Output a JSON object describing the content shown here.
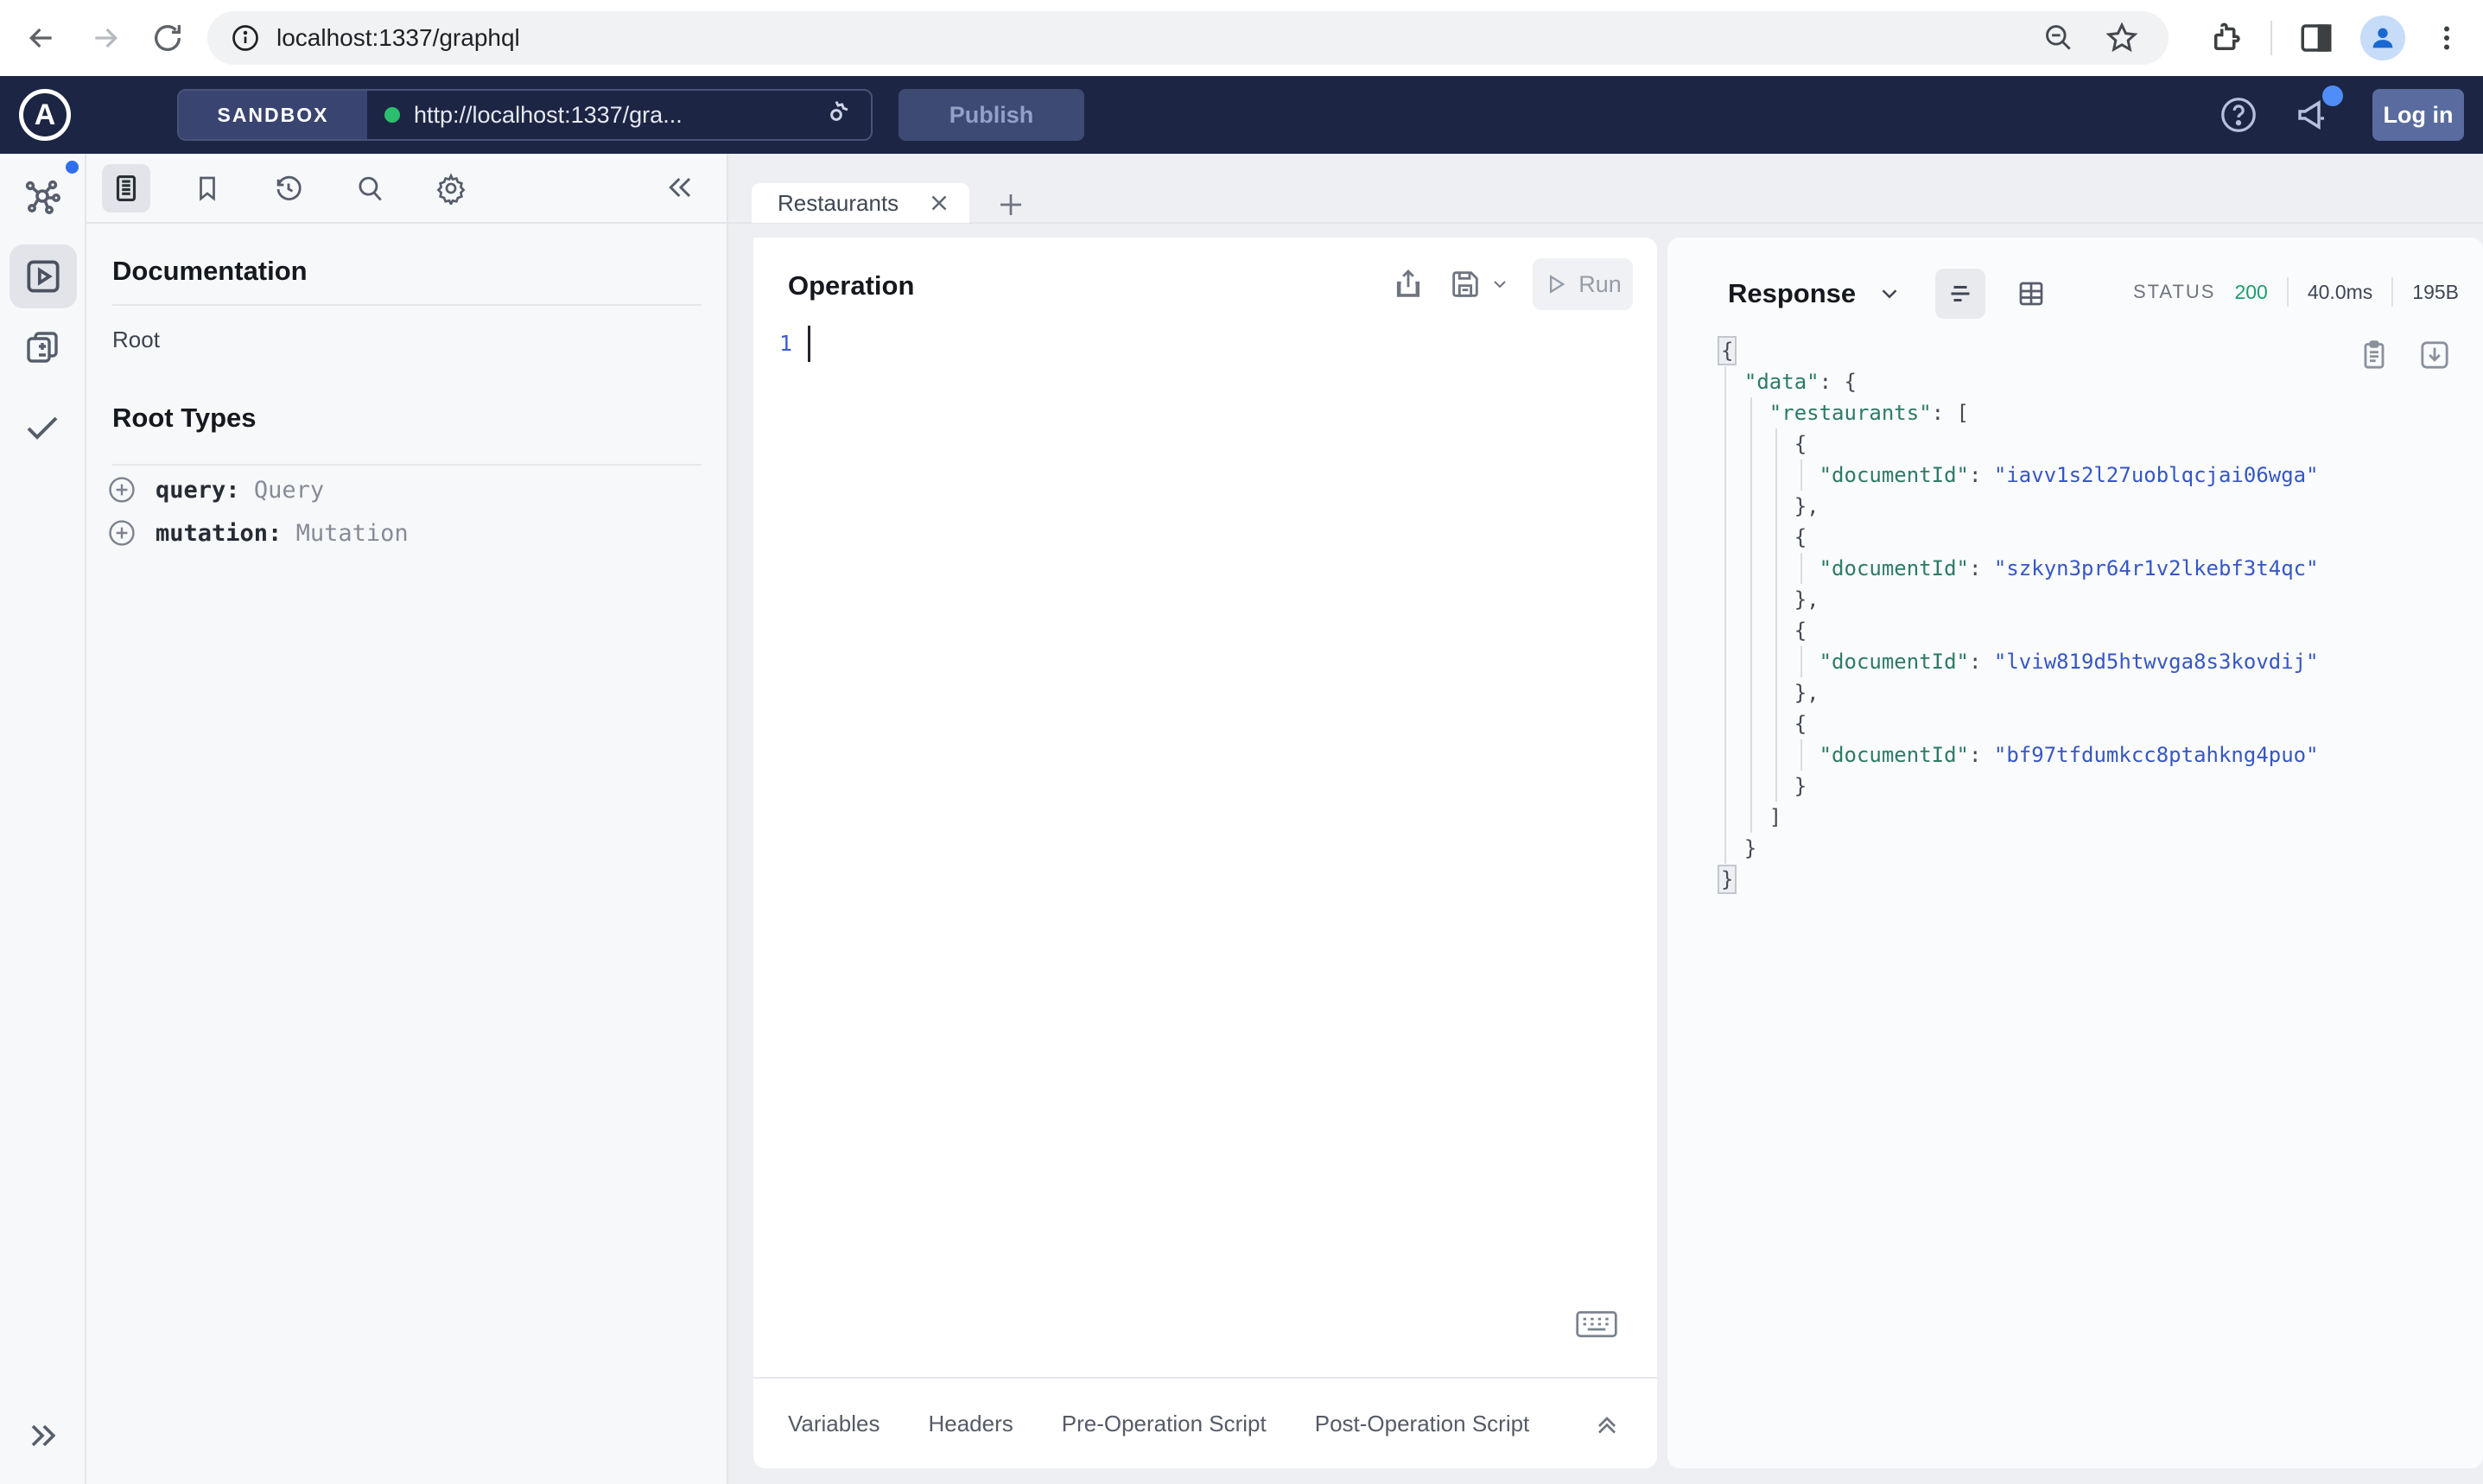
{
  "browser": {
    "url": "localhost:1337/graphql"
  },
  "header": {
    "logo_letter": "A",
    "sandbox_label": "SANDBOX",
    "endpoint_url": "http://localhost:1337/gra...",
    "publish_label": "Publish",
    "login_label": "Log in"
  },
  "docs": {
    "title": "Documentation",
    "root_label": "Root",
    "root_types_title": "Root Types",
    "entries": [
      {
        "name": "query:",
        "type": "Query"
      },
      {
        "name": "mutation:",
        "type": "Mutation"
      }
    ]
  },
  "editor": {
    "tab_label": "Restaurants",
    "panel_title": "Operation",
    "run_label": "Run",
    "line_number": "1"
  },
  "response": {
    "panel_title": "Response",
    "status_label": "STATUS",
    "status_code": "200",
    "time": "40.0ms",
    "size": "195B",
    "json_lines": [
      [
        [
          "f",
          "{"
        ]
      ],
      [
        [
          "p",
          "  "
        ],
        [
          "k",
          "\"data\""
        ],
        [
          "p",
          ": {"
        ]
      ],
      [
        [
          "p",
          "    "
        ],
        [
          "k",
          "\"restaurants\""
        ],
        [
          "p",
          ": ["
        ]
      ],
      [
        [
          "p",
          "      {"
        ]
      ],
      [
        [
          "p",
          "        "
        ],
        [
          "k",
          "\"documentId\""
        ],
        [
          "p",
          ": "
        ],
        [
          "v",
          "\"iavv1s2l27uoblqcjai06wga\""
        ]
      ],
      [
        [
          "p",
          "      },"
        ]
      ],
      [
        [
          "p",
          "      {"
        ]
      ],
      [
        [
          "p",
          "        "
        ],
        [
          "k",
          "\"documentId\""
        ],
        [
          "p",
          ": "
        ],
        [
          "v",
          "\"szkyn3pr64r1v2lkebf3t4qc\""
        ]
      ],
      [
        [
          "p",
          "      },"
        ]
      ],
      [
        [
          "p",
          "      {"
        ]
      ],
      [
        [
          "p",
          "        "
        ],
        [
          "k",
          "\"documentId\""
        ],
        [
          "p",
          ": "
        ],
        [
          "v",
          "\"lviw819d5htwvga8s3kovdij\""
        ]
      ],
      [
        [
          "p",
          "      },"
        ]
      ],
      [
        [
          "p",
          "      {"
        ]
      ],
      [
        [
          "p",
          "        "
        ],
        [
          "k",
          "\"documentId\""
        ],
        [
          "p",
          ": "
        ],
        [
          "v",
          "\"bf97tfdumkcc8ptahkng4puo\""
        ]
      ],
      [
        [
          "p",
          "      }"
        ]
      ],
      [
        [
          "p",
          "    ]"
        ]
      ],
      [
        [
          "p",
          "  }"
        ]
      ],
      [
        [
          "f",
          "}"
        ]
      ]
    ]
  },
  "footer": {
    "tabs": [
      "Variables",
      "Headers",
      "Pre-Operation Script",
      "Post-Operation Script"
    ]
  },
  "colors": {
    "header_bg": "#1c2543",
    "status_green": "#1c9e6d",
    "json_key": "#2d7a68",
    "json_value": "#3657c4",
    "accent_blue": "#2f6fed"
  }
}
